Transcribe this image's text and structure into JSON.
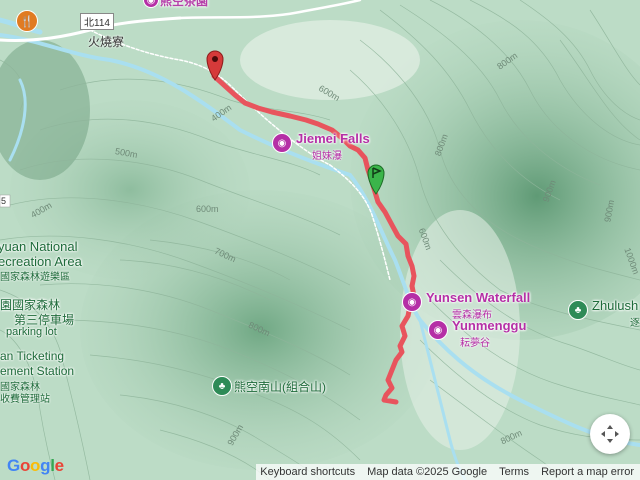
{
  "map": {
    "labels": {
      "village": "火燒寮",
      "road_shield": "北114",
      "jiemei_en": "Jiemei Falls",
      "jiemei_zh": "姐妹瀑",
      "yunsen_en": "Yunsen Waterfall",
      "yunsen_zh": "雲森瀑布",
      "yunmenggu_en": "Yunmenggu",
      "yunmenggu_zh": "耘夢谷",
      "zhulush": "Zhulush",
      "zhulush_zh": "逐",
      "peak": "熊空南山(組合山)",
      "park_line1": "yuan National",
      "park_line2": "ecreation Area",
      "park_line3": "國家森林遊樂區",
      "parking_zh1": "園國家森林",
      "parking_zh2": "第三停車場",
      "parking_en": "parking lot",
      "ticketing1": "an Ticketing",
      "ticketing2": "ement Station",
      "ticketing3": "國家森林",
      "ticketing4": "收費管理站",
      "top_cut": "熊空茶園",
      "edge_5": "5"
    },
    "elevations": {
      "e400a": "400m",
      "e400b": "400m",
      "e500": "500m",
      "e600a": "600m",
      "e600b": "600m",
      "e600c": "600m",
      "e700": "700m",
      "e800a": "800m",
      "e800b": "800m",
      "e800c": "800m",
      "e800d": "800m",
      "e900a": "900m",
      "e900b": "900m",
      "e900c": "900m",
      "e1000": "1000m"
    },
    "icons": {
      "poi": "camera-icon",
      "park": "tree-icon",
      "restaurant": "fork-knife-icon",
      "fullscreen": "fullscreen-icon"
    },
    "colors": {
      "track": "#e8545d",
      "start_marker": "#3bb54a",
      "end_marker": "#d63a3a",
      "poi": "#b52fa6",
      "park": "#2e8b57"
    }
  },
  "footer": {
    "shortcuts": "Keyboard shortcuts",
    "mapdata": "Map data ©2025 Google",
    "terms": "Terms",
    "report": "Report a map error"
  },
  "logo": {
    "text": "Google"
  }
}
